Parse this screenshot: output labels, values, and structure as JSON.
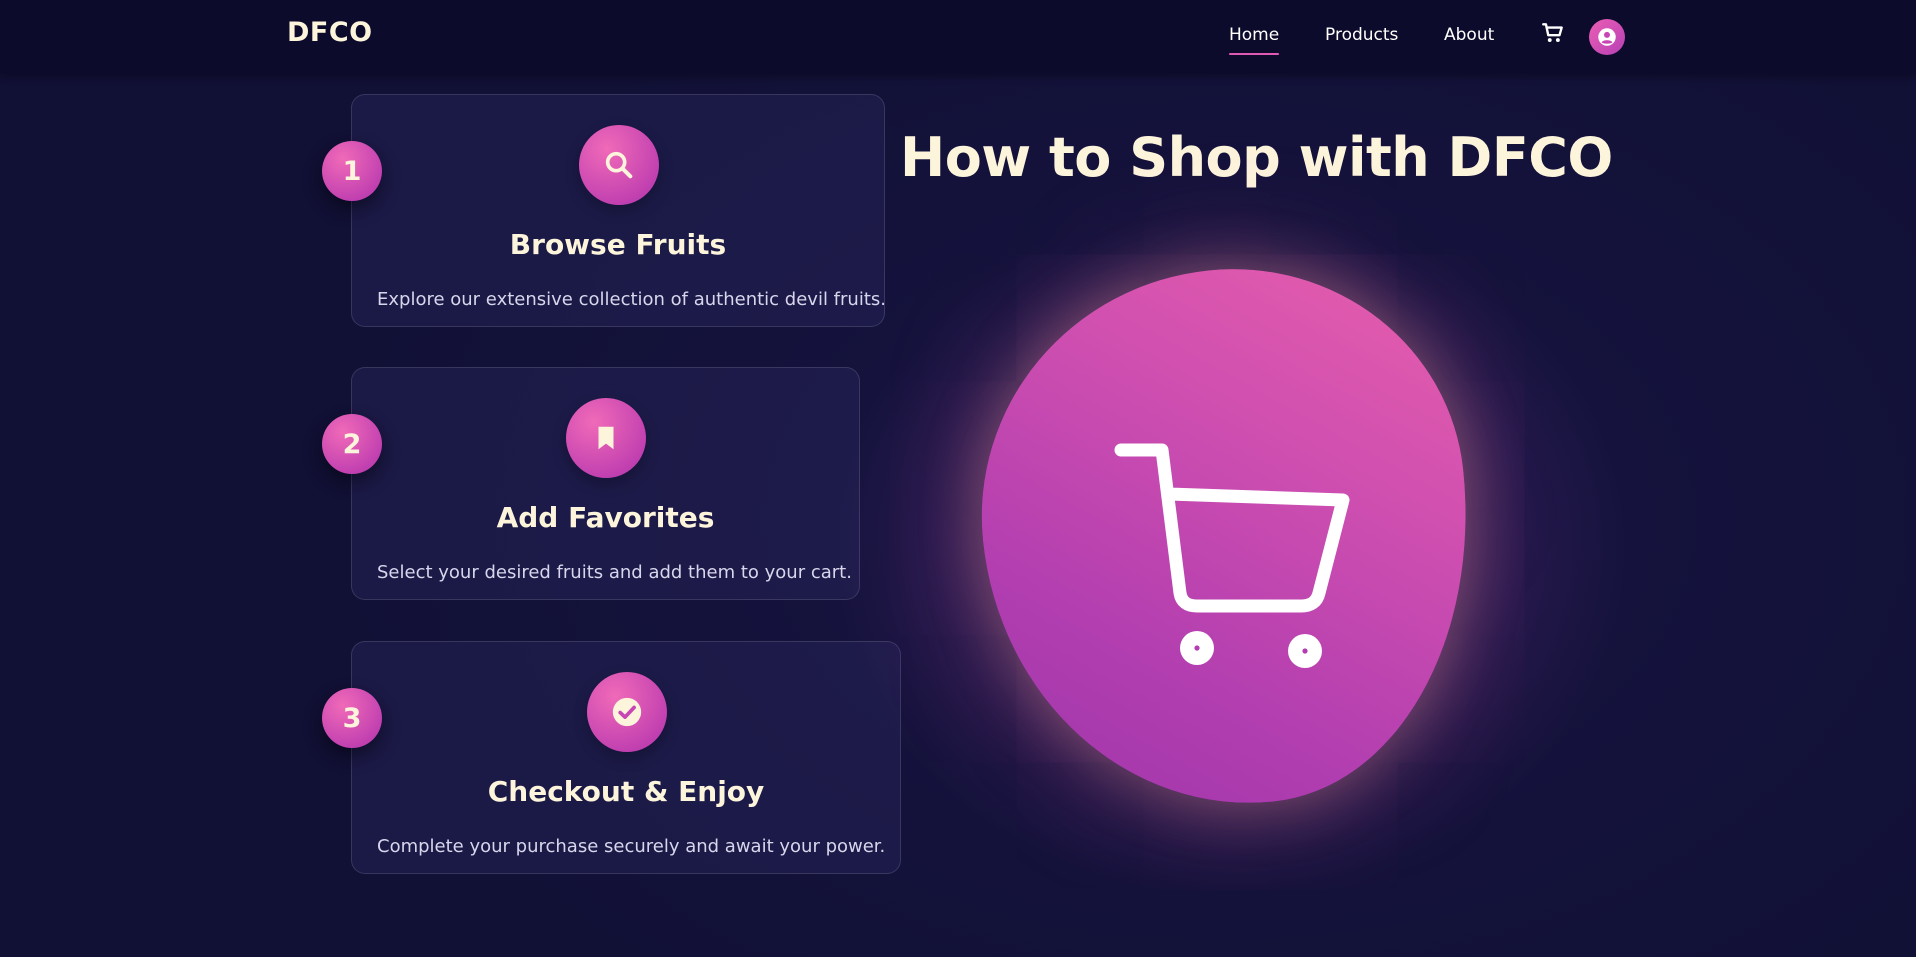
{
  "nav": {
    "brand": "DFCO",
    "links": [
      "Home",
      "Products",
      "About"
    ],
    "active": "Home",
    "icons": [
      "cart-icon",
      "user-icon"
    ]
  },
  "page": {
    "headline": "How to Shop with DFCO",
    "hero_icon": "cart-icon"
  },
  "steps": [
    {
      "number": "1",
      "icon": "search-icon",
      "title": "Browse Fruits",
      "description": "Explore our extensive collection of authentic devil fruits."
    },
    {
      "number": "2",
      "icon": "bookmark-icon",
      "title": "Add Favorites",
      "description": "Select your desired fruits and add them to your cart."
    },
    {
      "number": "3",
      "icon": "check-circle-icon",
      "title": "Checkout & Enjoy",
      "description": "Complete your purchase securely and await your power."
    }
  ],
  "colors": {
    "background": "#141339",
    "navbar": "#0c0b2b",
    "accent": "#d94fb2",
    "heading_text": "#fdf4dc"
  }
}
